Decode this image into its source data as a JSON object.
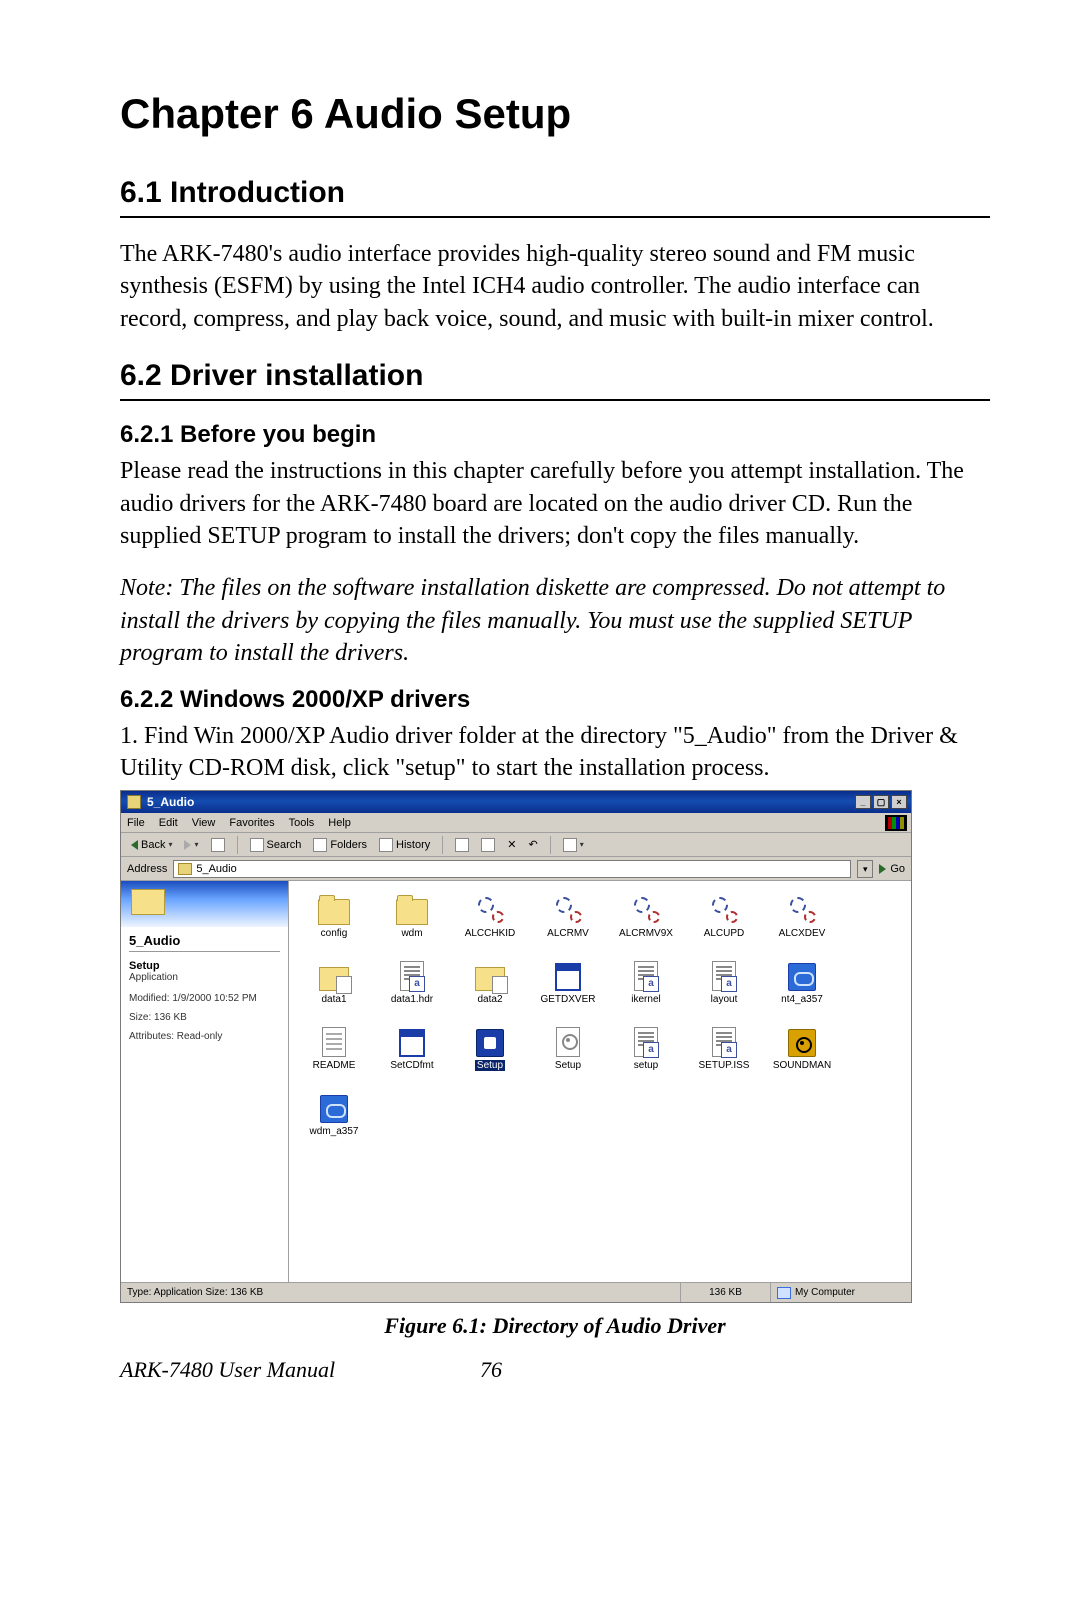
{
  "chapter_title": "Chapter 6  Audio Setup",
  "section_6_1": {
    "heading": "6.1  Introduction",
    "body": "The ARK-7480's audio interface provides high-quality stereo sound and FM music synthesis (ESFM) by using the Intel ICH4 audio controller. The audio interface can record, compress, and play back voice, sound, and music with built-in mixer control."
  },
  "section_6_2": {
    "heading": "6.2  Driver installation",
    "sub_6_2_1": {
      "heading": "6.2.1 Before you begin",
      "body": "Please read the instructions in this chapter carefully before you attempt installation. The audio drivers for the ARK-7480 board are located on the audio driver CD. Run the supplied SETUP program to install the drivers; don't copy the files manually.",
      "note": "Note: The files on the software installation diskette are compressed. Do not attempt to install the drivers by copying the files manually. You must use the supplied SETUP program to install the drivers."
    },
    "sub_6_2_2": {
      "heading": "6.2.2 Windows 2000/XP drivers",
      "body": "1. Find Win 2000/XP Audio driver folder at the directory \"5_Audio\" from the Driver & Utility CD-ROM disk, click \"setup\" to start the installation process."
    }
  },
  "figure_caption": "Figure 6.1: Directory of Audio Driver",
  "footer": {
    "manual": "ARK-7480 User Manual",
    "page": "76"
  },
  "screenshot": {
    "window_title": "5_Audio",
    "menus": [
      "File",
      "Edit",
      "View",
      "Favorites",
      "Tools",
      "Help"
    ],
    "toolbar": {
      "back": "Back",
      "search": "Search",
      "folders": "Folders",
      "history": "History"
    },
    "address": {
      "label": "Address",
      "value": "5_Audio",
      "go": "Go"
    },
    "leftpane": {
      "title": "5_Audio",
      "setup_name": "Setup",
      "setup_type": "Application",
      "modified": "Modified: 1/9/2000 10:52 PM",
      "size": "Size: 136 KB",
      "attributes": "Attributes: Read-only"
    },
    "files": {
      "row1": [
        "config",
        "wdm",
        "ALCCHKID",
        "ALCRMV",
        "ALCRMV9X",
        "ALCUPD",
        "ALCXDEV"
      ],
      "row2": [
        "data1",
        "data1.hdr",
        "data2",
        "GETDXVER",
        "ikernel",
        "layout",
        "nt4_a357"
      ],
      "row3": [
        "README",
        "SetCDfmt",
        "Setup",
        "Setup",
        "setup",
        "SETUP.ISS",
        "SOUNDMAN"
      ],
      "row4": [
        "wdm_a357"
      ]
    },
    "statusbar": {
      "left": "Type: Application Size: 136 KB",
      "mid": "136 KB",
      "right": "My Computer"
    }
  }
}
